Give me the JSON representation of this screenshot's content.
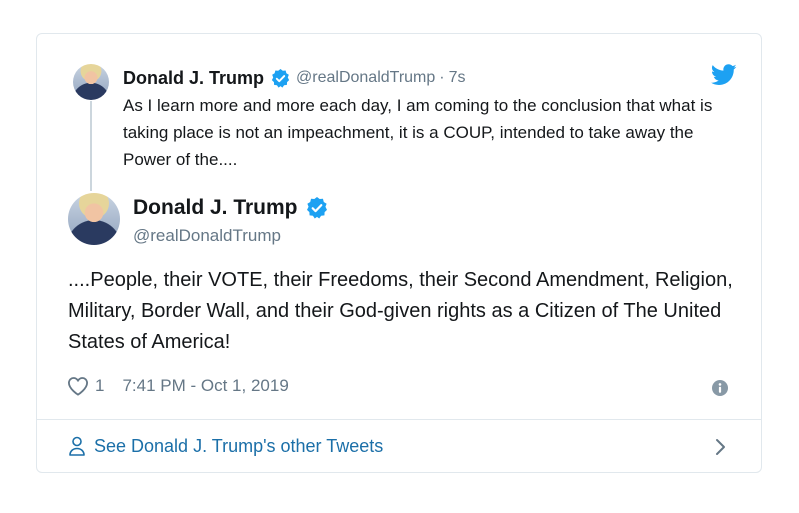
{
  "quoted": {
    "name": "Donald J. Trump",
    "handle": "@realDonaldTrump",
    "separator": "·",
    "time": "7s",
    "text": "As I learn more and more each day, I am coming to the conclusion that what is taking place is not an impeachment, it is a COUP, intended to take away the Power of the...."
  },
  "tweet": {
    "name": "Donald J. Trump",
    "handle": "@realDonaldTrump",
    "text": "....People, their VOTE, their Freedoms, their Second Amendment, Religion, Military, Border Wall, and their God-given rights as a Citizen of The United States of America!",
    "like_count": "1",
    "timestamp": "7:41 PM - Oct 1, 2019"
  },
  "footer": {
    "link_label": "See Donald J. Trump's other Tweets"
  },
  "icons": {
    "logo": "twitter-bird-icon",
    "verified": "verified-badge-icon",
    "like": "heart-icon",
    "info": "info-icon",
    "profile": "person-icon",
    "next": "chevron-right-icon"
  },
  "colors": {
    "twitter_blue": "#1da1f2",
    "link_blue": "#1b6fa8",
    "text": "#14171a",
    "secondary": "#657786",
    "border": "#e1e8ed"
  }
}
